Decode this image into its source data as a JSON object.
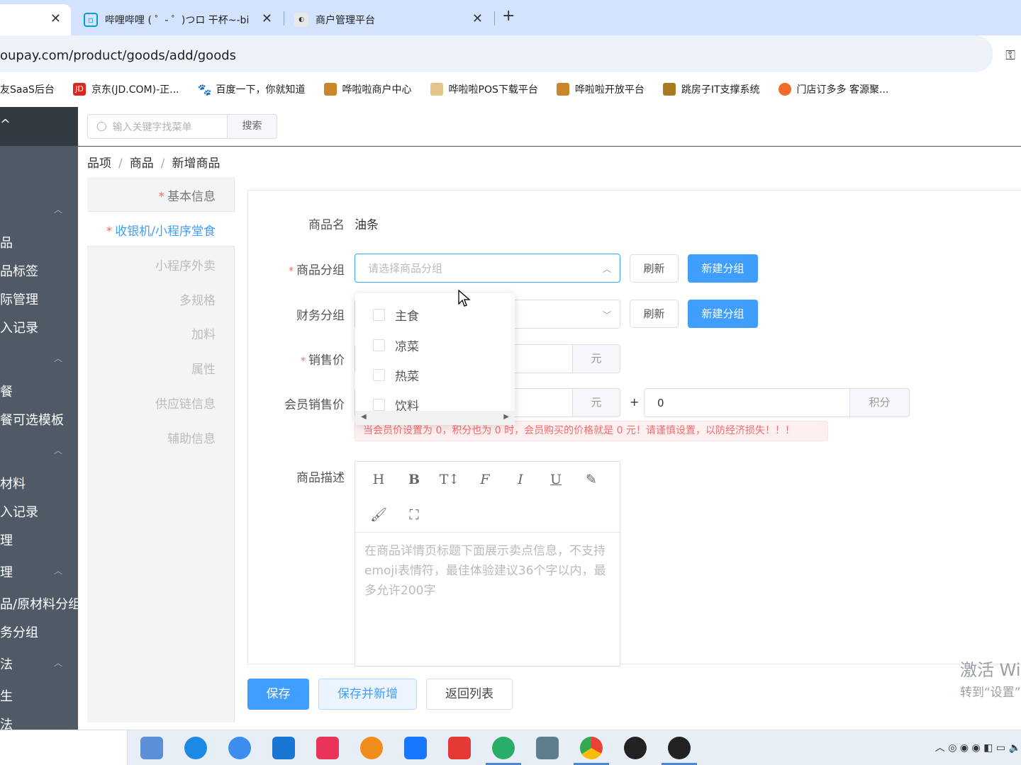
{
  "browser": {
    "tabs": [
      {
        "title": ""
      },
      {
        "title": "哔哩哔哩 ( ゜- ゜)つロ 干杯~-bi"
      },
      {
        "title": "商户管理平台"
      }
    ],
    "url": "oupay.com/product/goods/add/goods",
    "bookmarks": [
      {
        "label": "友SaaS后台"
      },
      {
        "label": "京东(JD.COM)-正..."
      },
      {
        "label": "百度一下，你就知道"
      },
      {
        "label": "哗啦啦商户中心"
      },
      {
        "label": "哗啦啦POS下载平台"
      },
      {
        "label": "哗啦啦开放平台"
      },
      {
        "label": "跳房子IT支撑系统"
      },
      {
        "label": "门店订多多 客源聚..."
      }
    ]
  },
  "sidebar": {
    "top_label": "^",
    "items": [
      "品",
      "品标签",
      "际管理",
      "入记录",
      "餐",
      "餐可选模板",
      "材料",
      "入记录",
      "理",
      "理",
      "品/原材料分组",
      "务分组",
      "法",
      "生",
      "法"
    ]
  },
  "search": {
    "placeholder": "输入关键字找菜单",
    "button": "搜索"
  },
  "breadcrumb": [
    "品项",
    "商品",
    "新增商品"
  ],
  "steps": [
    {
      "label": "基本信息",
      "required": true
    },
    {
      "label": "收银机/小程序堂食",
      "required": true
    },
    {
      "label": "小程序外卖"
    },
    {
      "label": "多规格"
    },
    {
      "label": "加料"
    },
    {
      "label": "属性"
    },
    {
      "label": "供应链信息"
    },
    {
      "label": "辅助信息"
    }
  ],
  "form": {
    "name_label": "商品名",
    "name_value": "油条",
    "group_label": "商品分组",
    "group_placeholder": "请选择商品分组",
    "refresh": "刷新",
    "new_group": "新建分组",
    "finance_label": "财务分组",
    "price_label": "销售价",
    "price_unit": "元",
    "member_price_label": "会员销售价",
    "member_unit": "元",
    "plus": "+",
    "points_value": "0",
    "points_unit": "积分",
    "warning": "当会员价设置为 0，积分也为 0 时，会员购买的价格就是 0 元！请谨慎设置，以防经济损失！！！",
    "desc_label": "商品描述",
    "desc_placeholder": "在商品详情页标题下面展示卖点信息，不支持emoji表情符，最佳体验建议36个字以内，最多允许200字"
  },
  "dropdown": {
    "options": [
      "主食",
      "凉菜",
      "热菜",
      "饮料"
    ]
  },
  "actions": {
    "save": "保存",
    "save_new": "保存并新增",
    "back": "返回列表"
  },
  "watermark": {
    "line1": "激活 Wi",
    "line2": "转到“设置”"
  },
  "colors": {
    "primary": "#409eff",
    "danger": "#f56c6c",
    "sidebar": "#4f5a66"
  }
}
